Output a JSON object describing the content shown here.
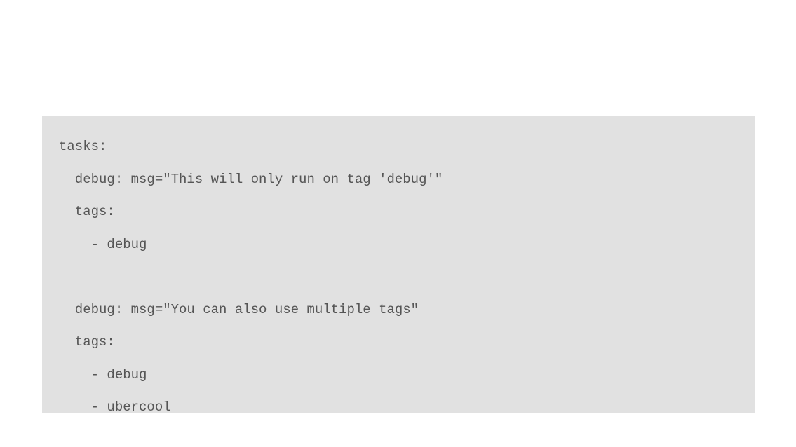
{
  "code": {
    "line1": "tasks:",
    "line2": "  debug: msg=\"This will only run on tag 'debug'\"",
    "line3": "  tags:",
    "line4": "    - debug",
    "line5": "",
    "line6": "  debug: msg=\"You can also use multiple tags\"",
    "line7": "  tags:",
    "line8": "    - debug",
    "line9": "    - ubercool"
  }
}
